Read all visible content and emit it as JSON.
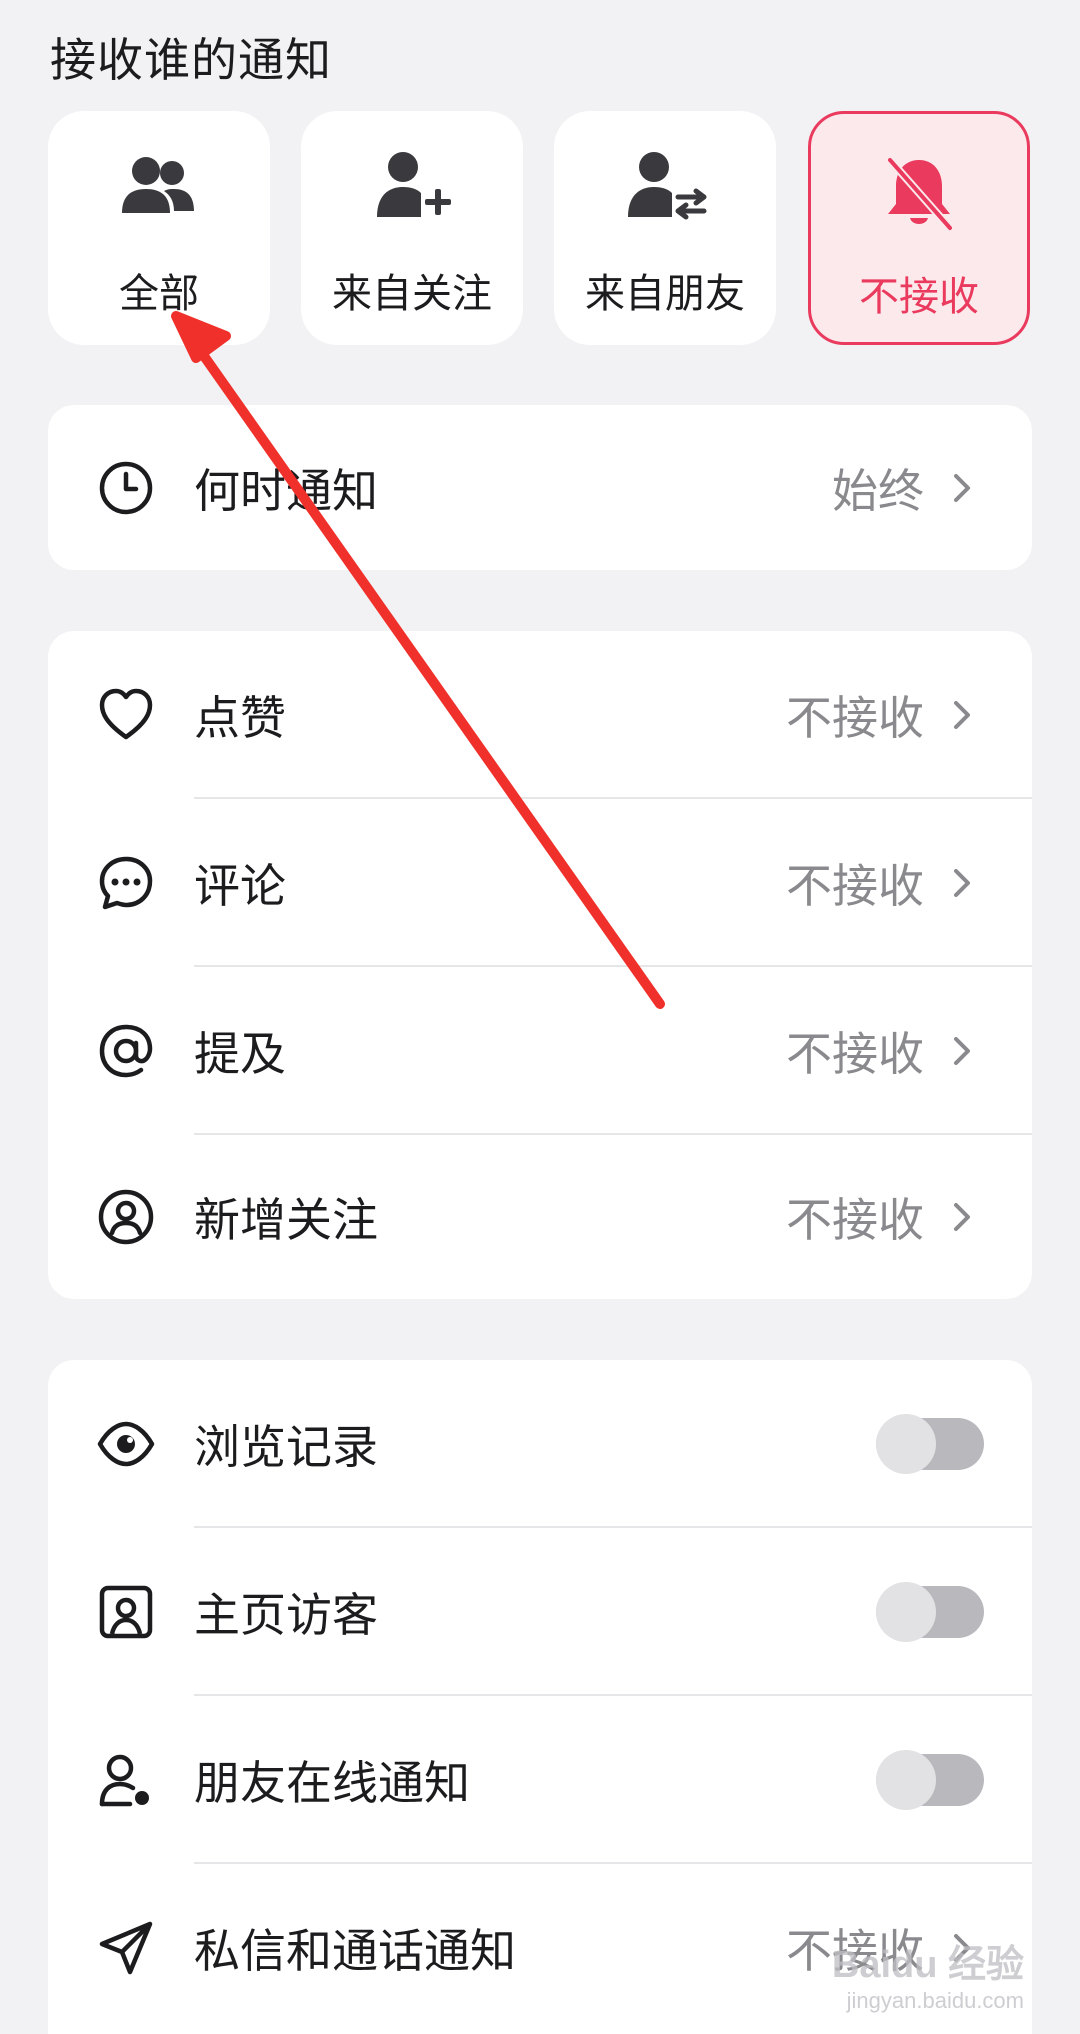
{
  "receive_section": {
    "title": "接收谁的通知",
    "options": [
      {
        "label": "全部",
        "icon": "group-users-icon",
        "selected": false
      },
      {
        "label": "来自关注",
        "icon": "user-add-icon",
        "selected": false
      },
      {
        "label": "来自朋友",
        "icon": "user-exchange-icon",
        "selected": false
      },
      {
        "label": "不接收",
        "icon": "bell-off-icon",
        "selected": true
      }
    ]
  },
  "when_card": {
    "label": "何时通知",
    "value": "始终",
    "icon": "clock-icon"
  },
  "notify_list": [
    {
      "label": "点赞",
      "value": "不接收",
      "icon": "heart-icon"
    },
    {
      "label": "评论",
      "value": "不接收",
      "icon": "comment-icon"
    },
    {
      "label": "提及",
      "value": "不接收",
      "icon": "at-icon"
    },
    {
      "label": "新增关注",
      "value": "不接收",
      "icon": "user-circle-icon"
    }
  ],
  "toggle_list": [
    {
      "label": "浏览记录",
      "icon": "eye-icon",
      "enabled": false
    },
    {
      "label": "主页访客",
      "icon": "profile-card-icon",
      "enabled": false
    },
    {
      "label": "朋友在线通知",
      "icon": "user-online-icon",
      "enabled": false
    },
    {
      "label": "私信和通话通知",
      "icon": "send-icon",
      "value": "不接收"
    }
  ],
  "watermark": {
    "main": "Baidu 经验",
    "sub": "jingyan.baidu.com"
  },
  "colors": {
    "accent": "#ea3a5d",
    "background": "#f2f2f4",
    "annotation_arrow": "#f0302a"
  }
}
